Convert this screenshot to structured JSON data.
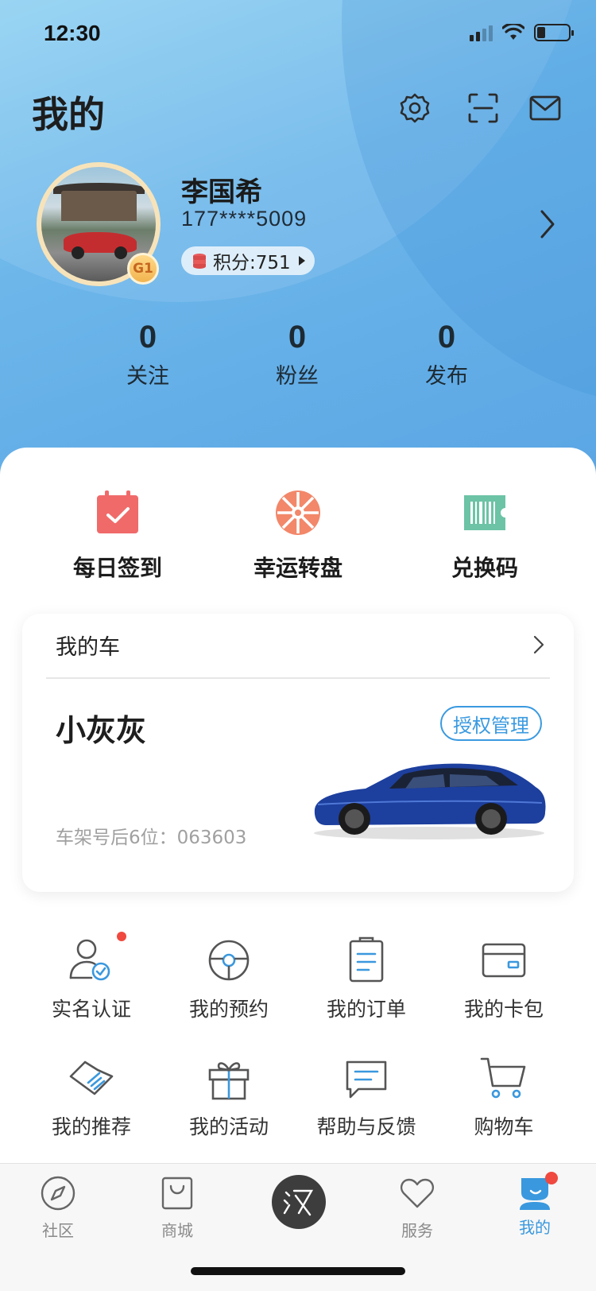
{
  "status_bar": {
    "time": "12:30"
  },
  "header": {
    "title": "我的"
  },
  "profile": {
    "name": "李国希",
    "phone": "177****5009",
    "points_label": "积分:751",
    "level": "G1"
  },
  "stats": [
    {
      "value": "0",
      "label": "关注"
    },
    {
      "value": "0",
      "label": "粉丝"
    },
    {
      "value": "0",
      "label": "发布"
    }
  ],
  "quick_actions": [
    {
      "label": "每日签到",
      "icon": "calendar-check-icon"
    },
    {
      "label": "幸运转盘",
      "icon": "lucky-wheel-icon"
    },
    {
      "label": "兑换码",
      "icon": "barcode-ticket-icon"
    }
  ],
  "my_car": {
    "header": "我的车",
    "name": "小灰灰",
    "auth_button": "授权管理",
    "vin_label": "车架号后6位：063603"
  },
  "services": [
    {
      "label": "实名认证",
      "icon": "user-verify-icon"
    },
    {
      "label": "我的预约",
      "icon": "steering-wheel-icon"
    },
    {
      "label": "我的订单",
      "icon": "order-list-icon"
    },
    {
      "label": "我的卡包",
      "icon": "card-wallet-icon"
    },
    {
      "label": "我的推荐",
      "icon": "handshake-icon"
    },
    {
      "label": "我的活动",
      "icon": "gift-icon"
    },
    {
      "label": "帮助与反馈",
      "icon": "feedback-icon"
    },
    {
      "label": "购物车",
      "icon": "cart-icon"
    }
  ],
  "tabbar": {
    "items": [
      {
        "label": "社区",
        "icon": "compass-icon"
      },
      {
        "label": "商城",
        "icon": "shopping-bag-icon"
      },
      {
        "label": "服务",
        "icon": "heart-icon"
      },
      {
        "label": "我的",
        "icon": "person-icon"
      }
    ],
    "center_logo": "汉",
    "active": "我的"
  },
  "colors": {
    "accent": "#3a98de",
    "badge_red": "#f0493f",
    "checkin_red": "#f06a6a",
    "wheel_orange": "#f2876a",
    "ticket_green": "#6cc3a6"
  }
}
